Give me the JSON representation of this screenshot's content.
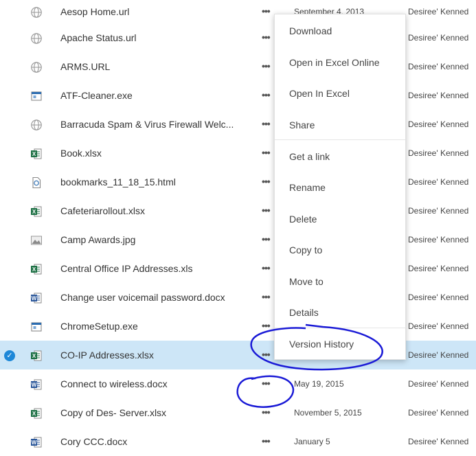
{
  "files": [
    {
      "name": "Aesop Home.url",
      "icon": "web-link-icon",
      "more": "•••",
      "date": "September 4, 2013",
      "modified_by": "Desiree' Kenned"
    },
    {
      "name": "Apache Status.url",
      "icon": "web-link-icon",
      "more": "•••",
      "date": "",
      "modified_by": "Desiree' Kenned"
    },
    {
      "name": "ARMS.URL",
      "icon": "web-link-icon",
      "more": "•••",
      "date": "",
      "modified_by": "Desiree' Kenned"
    },
    {
      "name": "ATF-Cleaner.exe",
      "icon": "exe-file-icon",
      "more": "•••",
      "date": "",
      "modified_by": "Desiree' Kenned"
    },
    {
      "name": "Barracuda Spam & Virus Firewall Welc...",
      "icon": "web-link-icon",
      "more": "•••",
      "date": "",
      "modified_by": "Desiree' Kenned"
    },
    {
      "name": "Book.xlsx",
      "icon": "excel-file-icon",
      "more": "•••",
      "date": "",
      "modified_by": "Desiree' Kenned"
    },
    {
      "name": "bookmarks_11_18_15.html",
      "icon": "html-file-icon",
      "more": "•••",
      "date": "",
      "modified_by": "Desiree' Kenned"
    },
    {
      "name": "Cafeteriarollout.xlsx",
      "icon": "excel-file-icon",
      "more": "•••",
      "date": "",
      "modified_by": "Desiree' Kenned"
    },
    {
      "name": "Camp Awards.jpg",
      "icon": "image-file-icon",
      "more": "•••",
      "date": "",
      "modified_by": "Desiree' Kenned"
    },
    {
      "name": "Central Office IP Addresses.xls",
      "icon": "excel-file-icon",
      "more": "•••",
      "date": "",
      "modified_by": "Desiree' Kenned"
    },
    {
      "name": "Change user voicemail password.docx",
      "icon": "word-file-icon",
      "more": "•••",
      "date": "",
      "modified_by": "Desiree' Kenned"
    },
    {
      "name": "ChromeSetup.exe",
      "icon": "exe-file-icon",
      "more": "•••",
      "date": "",
      "modified_by": "Desiree' Kenned"
    },
    {
      "name": "CO-IP Addresses.xlsx",
      "icon": "excel-file-icon",
      "more": "•••",
      "date": "",
      "modified_by": "Desiree' Kenned",
      "selected": true
    },
    {
      "name": "Connect to wireless.docx",
      "icon": "word-file-icon",
      "more": "•••",
      "date": "May 19, 2015",
      "modified_by": "Desiree' Kenned"
    },
    {
      "name": "Copy of Des- Server.xlsx",
      "icon": "excel-file-icon",
      "more": "•••",
      "date": "November 5, 2015",
      "modified_by": "Desiree' Kenned"
    },
    {
      "name": "Cory CCC.docx",
      "icon": "word-file-icon",
      "more": "•••",
      "date": "January 5",
      "modified_by": "Desiree' Kenned"
    }
  ],
  "context_menu": {
    "items": [
      {
        "label": "Download"
      },
      {
        "label": "Open in Excel Online"
      },
      {
        "label": "Open In Excel"
      },
      {
        "label": "Share"
      },
      {
        "label": "Get a link"
      },
      {
        "label": "Rename"
      },
      {
        "label": "Delete"
      },
      {
        "label": "Copy to"
      },
      {
        "label": "Move to"
      },
      {
        "label": "Details"
      },
      {
        "label": "Version History"
      }
    ]
  },
  "colors": {
    "selected_row": "#cde6f7",
    "check": "#1e88d8",
    "excel": "#1e7145",
    "word": "#2b579a",
    "annotation": "#1a1ad6"
  }
}
